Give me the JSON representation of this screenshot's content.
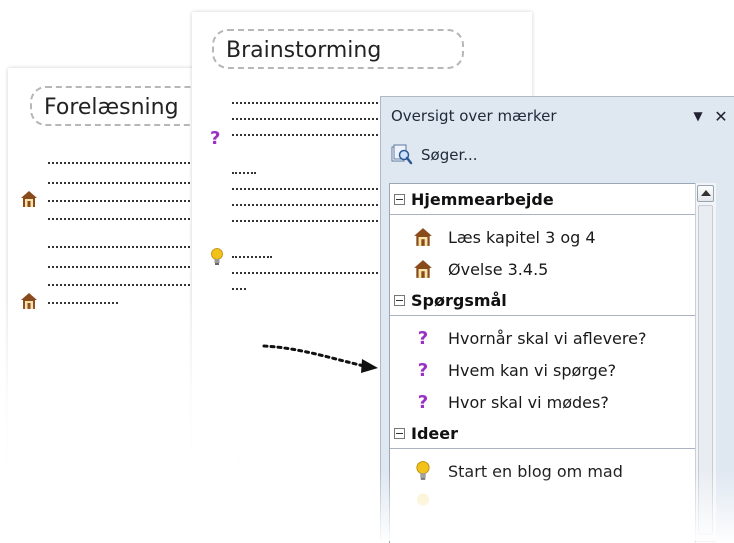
{
  "pages": {
    "page1_title": "Forelæsning",
    "page2_title": "Brainstorming"
  },
  "pane": {
    "title": "Oversigt over mærker",
    "search_label": "Søger...",
    "groups": [
      {
        "name": "Hjemmearbejde",
        "items": [
          {
            "label": "Læs kapitel 3 og 4",
            "icon": "house-icon"
          },
          {
            "label": "Øvelse 3.4.5",
            "icon": "house-icon"
          }
        ]
      },
      {
        "name": "Spørgsmål",
        "items": [
          {
            "label": "Hvornår skal vi aflevere?",
            "icon": "question-icon"
          },
          {
            "label": "Hvem kan vi spørge?",
            "icon": "question-icon"
          },
          {
            "label": "Hvor skal vi mødes?",
            "icon": "question-icon"
          }
        ]
      },
      {
        "name": "Ideer",
        "items": [
          {
            "label": "Start en blog om mad",
            "icon": "lightbulb-icon"
          }
        ]
      }
    ]
  },
  "colors": {
    "pane_bg": "#dfe7f1",
    "question": "#9b2fc6",
    "house_roof": "#8a4b1c",
    "bulb": "#f2c21b"
  }
}
